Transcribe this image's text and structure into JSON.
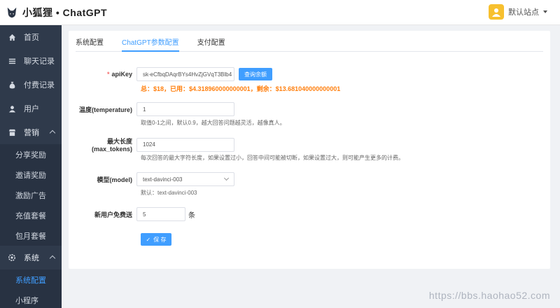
{
  "header": {
    "logo_text": "小狐狸 • ChatGPT",
    "user_name": "默认站点"
  },
  "sidebar": {
    "items": [
      {
        "label": "首页",
        "icon": "home-icon"
      },
      {
        "label": "聊天记录",
        "icon": "list-icon"
      },
      {
        "label": "付费记录",
        "icon": "money-bag-icon"
      },
      {
        "label": "用户",
        "icon": "user-icon"
      },
      {
        "label": "营销",
        "icon": "shop-icon"
      }
    ],
    "marketing_sub": [
      "分享奖励",
      "邀请奖励",
      "激励广告",
      "充值套餐",
      "包月套餐"
    ],
    "system": {
      "label": "系统",
      "icon": "gear-icon"
    },
    "system_sub": [
      "系统配置",
      "小程序"
    ]
  },
  "tabs": [
    "系统配置",
    "ChatGPT参数配置",
    "支付配置"
  ],
  "form": {
    "apikey": {
      "label": "apiKey",
      "value": "sk-eCfbqDAqrBYs4HvZjGVqT3Blb4",
      "query_button": "查询余额",
      "balance_text": "总：$18，已用：$4.318960000000001，剩余：$13.681040000000001"
    },
    "temperature": {
      "label": "温度(temperature)",
      "value": "1",
      "hint": "取值0-1之间，默认0.9，越大回答问题越灵活，越像真人。"
    },
    "max_tokens": {
      "label": "最大长度(max_tokens)",
      "value": "1024",
      "hint": "每次回答的最大字符长度，如果设置过小，回答中间可能被切断，如果设置过大，则可能产生更多的计费。"
    },
    "model": {
      "label": "模型(model)",
      "value": "text-davinci-003",
      "hint": "默认：text-davinci-003"
    },
    "free_count": {
      "label": "新用户免费送",
      "value": "5",
      "unit": "条"
    },
    "save_button": "保 存"
  },
  "watermark": "https://bbs.haohao52.com",
  "colors": {
    "sidebar_bg": "#2f3a4b",
    "accent": "#409eff",
    "balance": "#ff7f0e",
    "avatar": "#f7c02f"
  }
}
